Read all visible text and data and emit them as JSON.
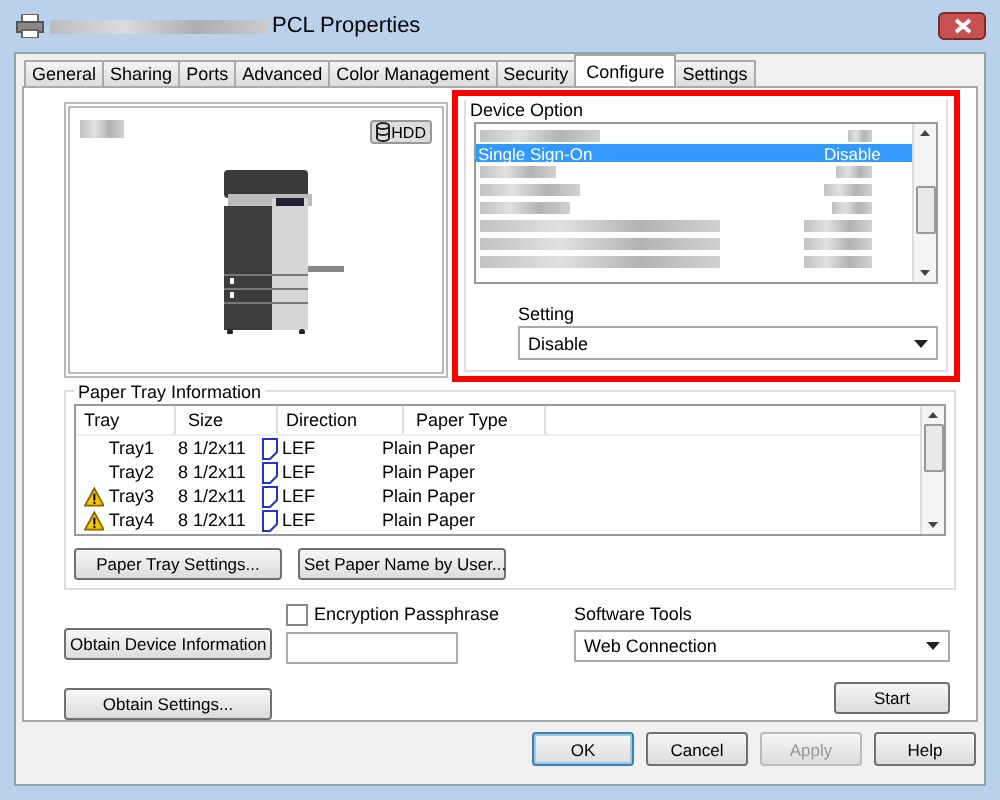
{
  "window": {
    "title": "PCL Properties"
  },
  "tabs": [
    {
      "label": "General",
      "selected": false
    },
    {
      "label": "Sharing",
      "selected": false
    },
    {
      "label": "Ports",
      "selected": false
    },
    {
      "label": "Advanced",
      "selected": false
    },
    {
      "label": "Color Management",
      "selected": false
    },
    {
      "label": "Security",
      "selected": false
    },
    {
      "label": "Configure",
      "selected": true
    },
    {
      "label": "Settings",
      "selected": false
    }
  ],
  "preview": {
    "badge": "HDD"
  },
  "device_option": {
    "label": "Device Option",
    "rows": [
      {
        "kind": "blurred",
        "selected": false
      },
      {
        "kind": "text",
        "name": "Single Sign-On",
        "value": "Disable",
        "selected": true
      },
      {
        "kind": "blurred",
        "selected": false
      },
      {
        "kind": "blurred",
        "selected": false
      },
      {
        "kind": "blurred",
        "selected": false
      },
      {
        "kind": "blurred",
        "selected": false
      },
      {
        "kind": "blurred",
        "selected": false
      },
      {
        "kind": "blurred",
        "selected": false
      }
    ],
    "setting_label": "Setting",
    "setting_value": "Disable"
  },
  "paper_tray": {
    "label": "Paper Tray Information",
    "columns": [
      "Tray",
      "Size",
      "Direction",
      "Paper Type"
    ],
    "rows": [
      {
        "tray": "Tray1",
        "size": "8 1/2x11",
        "direction": "LEF",
        "paper_type": "Plain Paper",
        "warning": false
      },
      {
        "tray": "Tray2",
        "size": "8 1/2x11",
        "direction": "LEF",
        "paper_type": "Plain Paper",
        "warning": false
      },
      {
        "tray": "Tray3",
        "size": "8 1/2x11",
        "direction": "LEF",
        "paper_type": "Plain Paper",
        "warning": true
      },
      {
        "tray": "Tray4",
        "size": "8 1/2x11",
        "direction": "LEF",
        "paper_type": "Plain Paper",
        "warning": true
      }
    ],
    "buttons": [
      "Paper Tray Settings...",
      "Set Paper Name by User..."
    ]
  },
  "obtain_device_info": "Obtain Device Information",
  "obtain_settings": "Obtain Settings...",
  "encryption": {
    "label": "Encryption Passphrase",
    "checked": false
  },
  "software_tools": {
    "label": "Software Tools",
    "value": "Web Connection",
    "button": "Start"
  },
  "footer": [
    {
      "label": "OK",
      "disabled": false,
      "default": true
    },
    {
      "label": "Cancel",
      "disabled": false,
      "default": false
    },
    {
      "label": "Apply",
      "disabled": true,
      "default": false
    },
    {
      "label": "Help",
      "disabled": false,
      "default": false
    }
  ]
}
